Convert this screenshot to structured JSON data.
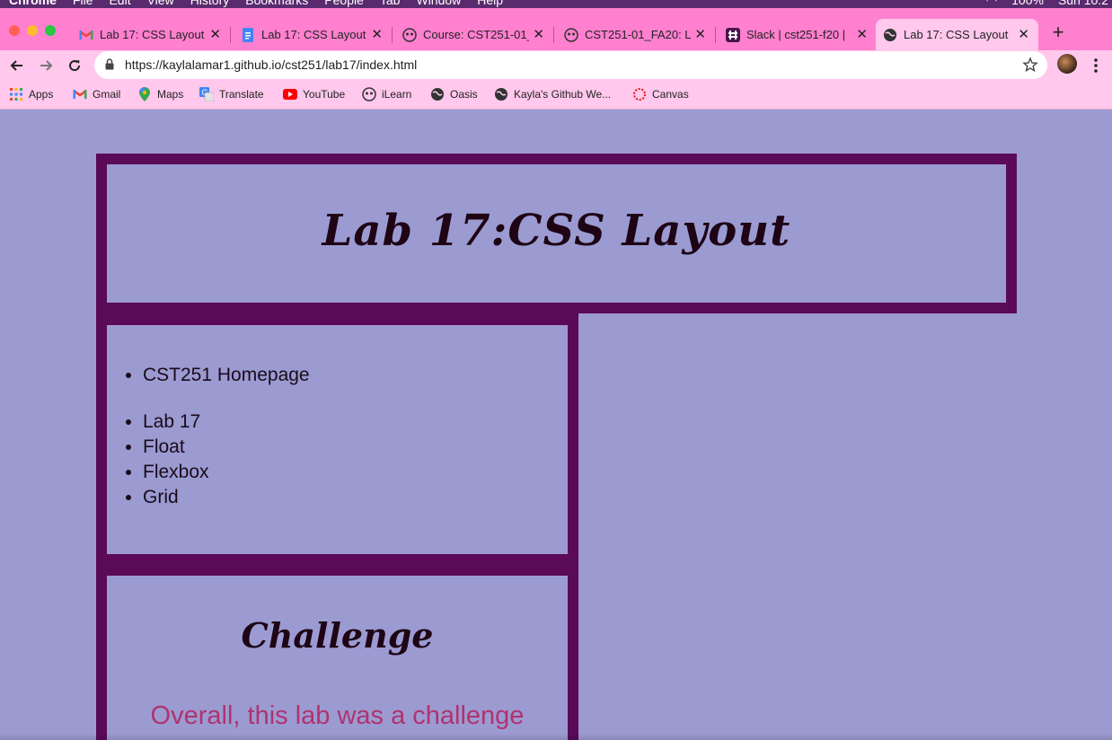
{
  "mac_menubar": {
    "items": [
      "Chrome",
      "File",
      "Edit",
      "View",
      "History",
      "Bookmarks",
      "People",
      "Tab",
      "Window",
      "Help"
    ],
    "battery": "100%",
    "clock": "Sun 10:2"
  },
  "tabs": [
    {
      "title": "Lab 17: CSS Layout",
      "icon": "gmail-icon",
      "active": false
    },
    {
      "title": "Lab 17: CSS Layout",
      "icon": "google-docs-icon",
      "active": false
    },
    {
      "title": "Course: CST251-01_",
      "icon": "ilearn-icon",
      "active": false
    },
    {
      "title": "CST251-01_FA20: L",
      "icon": "ilearn-icon",
      "active": false
    },
    {
      "title": "Slack | cst251-f20 |",
      "icon": "slack-icon",
      "active": false
    },
    {
      "title": "Lab 17: CSS Layout",
      "icon": "globe-icon",
      "active": true
    }
  ],
  "toolbar": {
    "url": "https://kaylalamar1.github.io/cst251/lab17/index.html"
  },
  "bookmarks": [
    {
      "label": "Apps",
      "icon": "apps-grid-icon"
    },
    {
      "label": "Gmail",
      "icon": "gmail-icon"
    },
    {
      "label": "Maps",
      "icon": "maps-pin-icon"
    },
    {
      "label": "Translate",
      "icon": "translate-icon"
    },
    {
      "label": "YouTube",
      "icon": "youtube-icon"
    },
    {
      "label": "iLearn",
      "icon": "ilearn-icon"
    },
    {
      "label": "Oasis",
      "icon": "globe-icon"
    },
    {
      "label": "Kayla's Github We...",
      "icon": "globe-icon"
    },
    {
      "label": "Canvas",
      "icon": "canvas-icon"
    }
  ],
  "page": {
    "title": "Lab 17:CSS Layout",
    "nav_items": [
      "CST251 Homepage",
      "Lab 17",
      "Float",
      "Flexbox",
      "Grid"
    ],
    "challenge_heading": "Challenge",
    "challenge_text": "Overall, this lab was a challenge"
  },
  "colors": {
    "page_background": "#9b9bd2",
    "border_purple": "#5a0a57",
    "tab_strip": "#ff80cf",
    "toolbar": "#ffc8ec",
    "challenge_text": "#b0336e"
  }
}
